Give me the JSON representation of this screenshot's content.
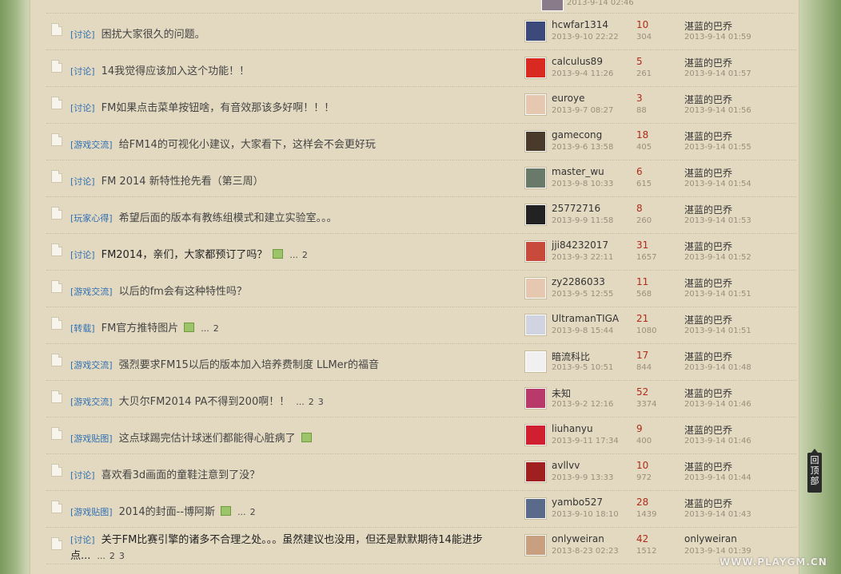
{
  "top_partial": {
    "date": "2013-9-14 02:46"
  },
  "threads": [
    {
      "category": "[讨论]",
      "title": "困扰大家很久的问题。",
      "has_image": false,
      "pages": [],
      "author": "hcwfar1314",
      "date": "2013-9-10 22:22",
      "replies": "10",
      "views": "304",
      "last_user": "湛蓝的巴乔",
      "last_time": "2013-9-14 01:59",
      "avatar_color": "#3b4a7a"
    },
    {
      "category": "[讨论]",
      "title": "14我觉得应该加入这个功能！！",
      "has_image": false,
      "pages": [],
      "author": "calculus89",
      "date": "2013-9-4 11:26",
      "replies": "5",
      "views": "261",
      "last_user": "湛蓝的巴乔",
      "last_time": "2013-9-14 01:57",
      "avatar_color": "#d82a20"
    },
    {
      "category": "[讨论]",
      "title": "FM如果点击菜单按钮啥，有音效那该多好啊！！！",
      "has_image": false,
      "pages": [],
      "author": "euroye",
      "date": "2013-9-7 08:27",
      "replies": "3",
      "views": "88",
      "last_user": "湛蓝的巴乔",
      "last_time": "2013-9-14 01:56",
      "avatar_color": "#e6c8b0"
    },
    {
      "category": "[游戏交流]",
      "title": "给FM14的可视化小建议，大家看下，这样会不会更好玩",
      "has_image": false,
      "pages": [],
      "author": "gamecong",
      "date": "2013-9-6 13:58",
      "replies": "18",
      "views": "405",
      "last_user": "湛蓝的巴乔",
      "last_time": "2013-9-14 01:55",
      "avatar_color": "#4a3a2a"
    },
    {
      "category": "[讨论]",
      "title": "FM 2014 新特性抢先看（第三周）",
      "has_image": false,
      "pages": [],
      "author": "master_wu",
      "date": "2013-9-8 10:33",
      "replies": "6",
      "views": "615",
      "last_user": "湛蓝的巴乔",
      "last_time": "2013-9-14 01:54",
      "avatar_color": "#6a7a6a"
    },
    {
      "category": "[玩家心得]",
      "title": "希望后面的版本有教练组模式和建立实验室。。。",
      "has_image": false,
      "pages": [],
      "author": "25772716",
      "date": "2013-9-9 11:58",
      "replies": "8",
      "views": "260",
      "last_user": "湛蓝的巴乔",
      "last_time": "2013-9-14 01:53",
      "avatar_color": "#222222"
    },
    {
      "category": "[讨论]",
      "title": "FM2014，亲们，大家都预订了吗？",
      "has_image": true,
      "pages": [
        "2"
      ],
      "author": "jji84232017",
      "date": "2013-9-3 22:11",
      "replies": "31",
      "views": "1657",
      "last_user": "湛蓝的巴乔",
      "last_time": "2013-9-14 01:52",
      "avatar_color": "#c84a3a"
    },
    {
      "category": "[游戏交流]",
      "title": "以后的fm会有这种特性吗？",
      "has_image": false,
      "pages": [],
      "author": "zy2286033",
      "date": "2013-9-5 12:55",
      "replies": "11",
      "views": "568",
      "last_user": "湛蓝的巴乔",
      "last_time": "2013-9-14 01:51",
      "avatar_color": "#e6c8b0"
    },
    {
      "category": "[转载]",
      "title": "FM官方推特图片",
      "has_image": true,
      "pages": [
        "2"
      ],
      "author": "UltramanTIGA",
      "date": "2013-9-8 15:44",
      "replies": "21",
      "views": "1080",
      "last_user": "湛蓝的巴乔",
      "last_time": "2013-9-14 01:51",
      "avatar_color": "#d0d4e0"
    },
    {
      "category": "[游戏交流]",
      "title": "强烈要求FM15以后的版本加入培养费制度 LLMer的福音",
      "has_image": false,
      "pages": [],
      "author": "暗流科比",
      "date": "2013-9-5 10:51",
      "replies": "17",
      "views": "844",
      "last_user": "湛蓝的巴乔",
      "last_time": "2013-9-14 01:48",
      "avatar_color": "#f0f0f0"
    },
    {
      "category": "[游戏交流]",
      "title": "大贝尔FM2014 PA不得到200啊！！",
      "has_image": false,
      "pages": [
        "2",
        "3"
      ],
      "author": "未知",
      "date": "2013-9-2 12:16",
      "replies": "52",
      "views": "3374",
      "last_user": "湛蓝的巴乔",
      "last_time": "2013-9-14 01:46",
      "avatar_color": "#b83a6a"
    },
    {
      "category": "[游戏贴图]",
      "title": "这点球踢完估计球迷们都能得心脏病了",
      "has_image": true,
      "pages": [],
      "author": "liuhanyu",
      "date": "2013-9-11 17:34",
      "replies": "9",
      "views": "400",
      "last_user": "湛蓝的巴乔",
      "last_time": "2013-9-14 01:46",
      "avatar_color": "#d02030"
    },
    {
      "category": "[讨论]",
      "title": "喜欢看3d画面的童鞋注意到了没？",
      "has_image": false,
      "pages": [],
      "author": "avllvv",
      "date": "2013-9-9 13:33",
      "replies": "10",
      "views": "972",
      "last_user": "湛蓝的巴乔",
      "last_time": "2013-9-14 01:44",
      "avatar_color": "#a02020"
    },
    {
      "category": "[游戏贴图]",
      "title": "2014的封面--博阿斯",
      "has_image": true,
      "pages": [
        "2"
      ],
      "author": "yambo527",
      "date": "2013-9-10 18:10",
      "replies": "28",
      "views": "1439",
      "last_user": "湛蓝的巴乔",
      "last_time": "2013-9-14 01:43",
      "avatar_color": "#5a6a8a"
    },
    {
      "category": "[讨论]",
      "title": "关于FM比赛引擎的诸多不合理之处。。。虽然建议也没用，但还是默默期待14能进步点...",
      "has_image": false,
      "pages": [
        "2",
        "3"
      ],
      "author": "onlyweiran",
      "date": "2013-8-23 02:23",
      "replies": "42",
      "views": "1512",
      "last_user": "onlyweiran",
      "last_time": "2013-9-14 01:39",
      "avatar_color": "#c8a080"
    }
  ],
  "back_to_top": "回顶部",
  "watermark": "WWW.PLAYGM.CN"
}
